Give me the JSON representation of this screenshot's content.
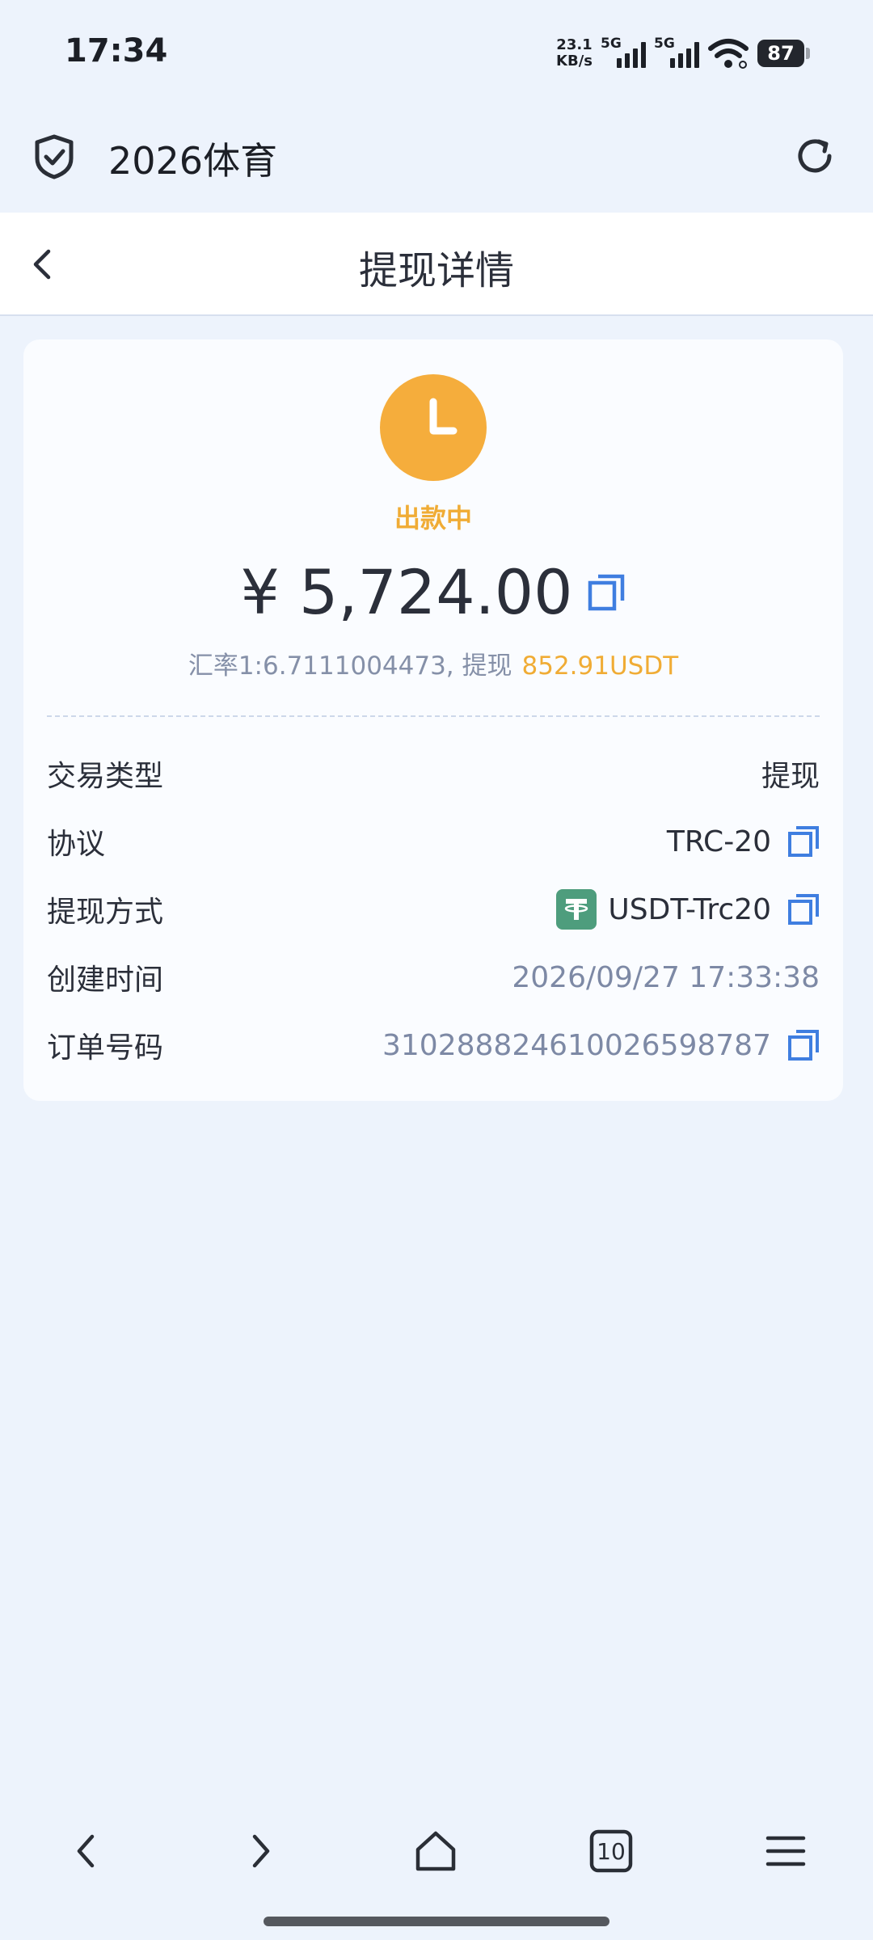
{
  "status_bar": {
    "time": "17:34",
    "net_speed_value": "23.1",
    "net_speed_unit": "KB/s",
    "sim1_tag": "5G",
    "sim2_tag": "5G",
    "battery": "87"
  },
  "browser": {
    "site_title": "2026体育",
    "shield_icon": "shield-check-icon",
    "reload_icon": "reload-icon"
  },
  "nav": {
    "title": "提现详情",
    "back_icon": "chevron-left-icon"
  },
  "card": {
    "status_icon": "clock-icon",
    "status_color": "#f0ac35",
    "status": "出款中",
    "amount": "¥ 5,724.00",
    "rate_text": "汇率1:6.7111004473, 提现",
    "usdt_amount": "852.91USDT",
    "rows": [
      {
        "label": "交易类型",
        "value": "提现"
      },
      {
        "label": "协议",
        "value": "TRC-20"
      },
      {
        "label": "提现方式",
        "value": "USDT-Trc20",
        "icon": "tether-icon"
      },
      {
        "label": "创建时间",
        "value": "2026/09/27 17:33:38"
      },
      {
        "label": "订单号码",
        "value": "310288824610026598787"
      }
    ]
  },
  "bottom_nav": {
    "back_icon": "chevron-left-icon",
    "forward_icon": "chevron-right-icon",
    "home_icon": "home-icon",
    "tabs_count": "10",
    "menu_icon": "menu-icon"
  },
  "colors": {
    "background": "#edf3fc",
    "accent_blue": "#3f7ee0",
    "amber": "#f0ac35",
    "muted_text": "#7d89a5"
  }
}
